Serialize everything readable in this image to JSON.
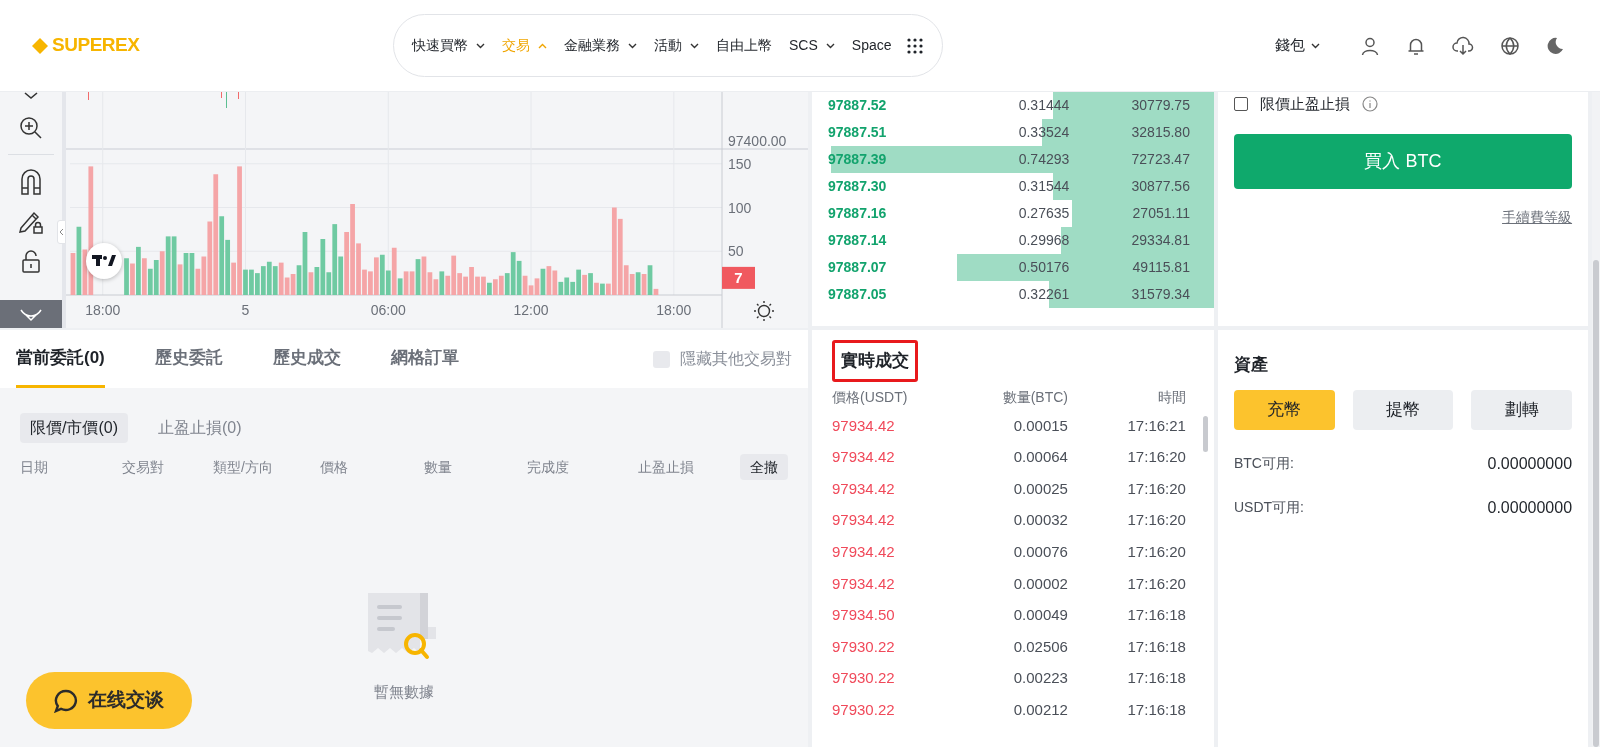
{
  "header": {
    "logo": "SUPEREX",
    "nav": [
      {
        "label": "快速買幣",
        "selected": false,
        "has_menu": true,
        "expanded": false
      },
      {
        "label": "交易",
        "selected": true,
        "has_menu": true,
        "expanded": true
      },
      {
        "label": "金融業務",
        "selected": false,
        "has_menu": true,
        "expanded": false
      },
      {
        "label": "活動",
        "selected": false,
        "has_menu": true,
        "expanded": false
      },
      {
        "label": "自由上幣",
        "selected": false,
        "has_menu": false
      },
      {
        "label": "SCS",
        "selected": false,
        "has_menu": true,
        "expanded": false
      },
      {
        "label": "Space",
        "selected": false,
        "has_menu": false
      }
    ],
    "wallet": "錢包"
  },
  "chart": {
    "price_label": "97400.00",
    "chart_data": {
      "type": "bar",
      "categories": [
        null,
        null,
        null,
        null,
        null,
        "18:00",
        null,
        null,
        null,
        null,
        null,
        null,
        null,
        null,
        null,
        null,
        null,
        null,
        null,
        null,
        null,
        null,
        null,
        null,
        null,
        null,
        null,
        null,
        null,
        "5",
        null,
        null,
        null,
        null,
        null,
        null,
        null,
        null,
        null,
        null,
        null,
        null,
        null,
        null,
        null,
        null,
        null,
        null,
        null,
        null,
        null,
        null,
        null,
        "06:00",
        null,
        null,
        null,
        null,
        null,
        null,
        null,
        null,
        null,
        null,
        null,
        null,
        null,
        null,
        null,
        null,
        null,
        null,
        null,
        null,
        null,
        null,
        null,
        "12:00",
        null,
        null,
        null,
        null,
        null,
        null,
        null,
        null,
        null,
        null,
        null,
        null,
        null,
        null,
        null,
        null,
        null,
        null,
        null,
        null,
        null,
        null,
        null,
        "18:00"
      ],
      "series": [
        {
          "color": "#6fcaa2",
          "values": [
            null,
            78,
            null,
            null,
            null,
            null,
            null,
            null,
            null,
            42,
            null,
            55,
            null,
            30,
            40,
            null,
            67,
            67,
            null,
            48,
            48,
            null,
            null,
            null,
            null,
            90,
            63,
            null,
            null,
            29,
            29,
            25,
            33,
            38,
            33,
            null,
            null,
            null,
            34,
            72,
            null,
            32,
            64,
            26,
            81,
            44,
            null,
            null,
            null,
            null,
            null,
            null,
            46,
            28,
            null,
            19,
            null,
            null,
            41,
            null,
            null,
            null,
            27,
            null,
            null,
            null,
            null,
            null,
            null,
            null,
            14,
            null,
            null,
            25,
            49,
            39,
            null,
            null,
            null,
            30,
            null,
            null,
            15,
            20,
            15,
            29,
            null,
            25,
            null,
            13,
            null,
            null,
            null,
            null,
            null,
            26,
            null,
            34,
            null,
            null,
            null,
            null
          ]
        },
        {
          "color": "#f5a5a7",
          "values": [
            48,
            null,
            52,
            147,
            null,
            null,
            null,
            null,
            null,
            null,
            36,
            null,
            42,
            null,
            null,
            50,
            null,
            null,
            35,
            null,
            null,
            30,
            44,
            84,
            138,
            null,
            null,
            37,
            147,
            null,
            null,
            null,
            null,
            null,
            null,
            37,
            20,
            24,
            null,
            null,
            26,
            null,
            null,
            null,
            null,
            null,
            72,
            104,
            59,
            29,
            27,
            43,
            null,
            null,
            54,
            null,
            27,
            27,
            null,
            44,
            26,
            18,
            null,
            22,
            45,
            25,
            21,
            32,
            21,
            21,
            null,
            18,
            22,
            null,
            null,
            null,
            22,
            11,
            19,
            null,
            33,
            28,
            null,
            null,
            null,
            null,
            23,
            null,
            14,
            null,
            13,
            100,
            87,
            34,
            24,
            null,
            24,
            null,
            7,
            null,
            null,
            null
          ]
        }
      ],
      "ylim": [
        0,
        232
      ],
      "grid": true,
      "yticks": [
        50,
        100,
        150
      ],
      "annotations": [
        "7"
      ]
    }
  },
  "orders": {
    "tabs": [
      {
        "label": "當前委託(0)",
        "selected": true
      },
      {
        "label": "歷史委託",
        "selected": false
      },
      {
        "label": "歷史成交",
        "selected": false
      },
      {
        "label": "網格訂單",
        "selected": false
      }
    ],
    "hide_other_pairs": {
      "label": "隱藏其他交易對",
      "checked": false
    },
    "subtabs": [
      {
        "label": "限價/市價(0)",
        "selected": true
      },
      {
        "label": "止盈止損(0)",
        "selected": false
      }
    ],
    "columns": [
      "日期",
      "交易對",
      "類型/方向",
      "價格",
      "數量",
      "完成度",
      "止盈止損"
    ],
    "cancel_all": "全撤",
    "empty_text": "暫無數據"
  },
  "chat_button": "在线交谈",
  "order_book": {
    "rows": [
      {
        "price": "97887.52",
        "amount": "0.31444",
        "total": "30779.75",
        "level": 0.42
      },
      {
        "price": "97887.51",
        "amount": "0.33524",
        "total": "32815.80",
        "level": 0.45
      },
      {
        "price": "97887.39",
        "amount": "0.74293",
        "total": "72723.47",
        "level": 1.0
      },
      {
        "price": "97887.30",
        "amount": "0.31544",
        "total": "30877.56",
        "level": 0.42
      },
      {
        "price": "97887.16",
        "amount": "0.27635",
        "total": "27051.11",
        "level": 0.37
      },
      {
        "price": "97887.14",
        "amount": "0.29968",
        "total": "29334.81",
        "level": 0.4
      },
      {
        "price": "97887.07",
        "amount": "0.50176",
        "total": "49115.81",
        "level": 0.67
      },
      {
        "price": "97887.05",
        "amount": "0.32261",
        "total": "31579.34",
        "level": 0.43
      }
    ]
  },
  "trades": {
    "title": "實時成交",
    "highlighted": true,
    "columns": [
      "價格(USDT)",
      "數量(BTC)",
      "時間"
    ],
    "rows": [
      {
        "price": "97934.42",
        "amount": "0.00015",
        "time": "17:16:21"
      },
      {
        "price": "97934.42",
        "amount": "0.00064",
        "time": "17:16:20"
      },
      {
        "price": "97934.42",
        "amount": "0.00025",
        "time": "17:16:20"
      },
      {
        "price": "97934.42",
        "amount": "0.00032",
        "time": "17:16:20"
      },
      {
        "price": "97934.42",
        "amount": "0.00076",
        "time": "17:16:20"
      },
      {
        "price": "97934.42",
        "amount": "0.00002",
        "time": "17:16:20"
      },
      {
        "price": "97934.50",
        "amount": "0.00049",
        "time": "17:16:18"
      },
      {
        "price": "97930.22",
        "amount": "0.02506",
        "time": "17:16:18"
      },
      {
        "price": "97930.22",
        "amount": "0.00223",
        "time": "17:16:18"
      },
      {
        "price": "97930.22",
        "amount": "0.00212",
        "time": "17:16:18"
      }
    ]
  },
  "trade_form": {
    "tp_sl": {
      "label": "限價止盈止損",
      "checked": false
    },
    "buy_button": "買入 BTC",
    "fee_link": "手續費等級"
  },
  "assets": {
    "title": "資產",
    "actions": [
      {
        "label": "充幣",
        "selected": true
      },
      {
        "label": "提幣",
        "selected": false
      },
      {
        "label": "劃轉",
        "selected": false
      }
    ],
    "balances": [
      {
        "label": "BTC可用:",
        "value": "0.00000000"
      },
      {
        "label": "USDT可用:",
        "value": "0.00000000"
      }
    ]
  }
}
